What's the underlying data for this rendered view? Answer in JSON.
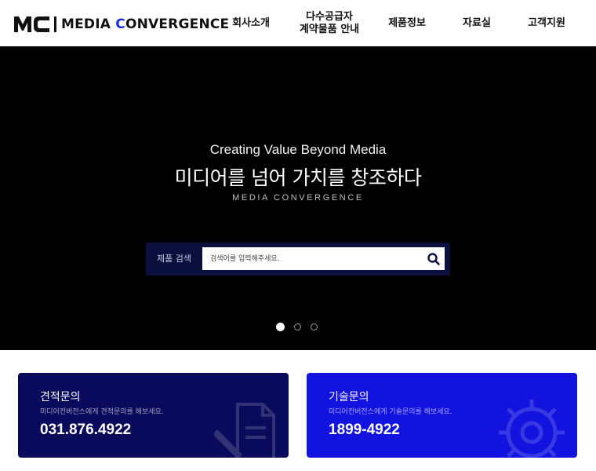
{
  "header": {
    "logo_text_prefix": "MEDIA ",
    "logo_text_c": "C",
    "logo_text_suffix": "ONVERGENCE",
    "nav": [
      {
        "label": "회사소개"
      },
      {
        "label_line1": "다수공급자",
        "label_line2": "계약물품 안내"
      },
      {
        "label": "제품정보"
      },
      {
        "label": "자료실"
      },
      {
        "label": "고객지원"
      }
    ]
  },
  "hero": {
    "subtitle": "Creating Value Beyond Media",
    "title": "미디어를 넘어 가치를 창조하다",
    "brand": "MEDIA CONVERGENCE",
    "search": {
      "label": "제품 검색",
      "placeholder": "검색어를 입력해주세요."
    },
    "slides": {
      "count": 3,
      "active": 1
    }
  },
  "cards": [
    {
      "title": "견적문의",
      "desc": "미디어컨버전스에게 견적문의를 해보세요.",
      "phone": "031.876.4922",
      "icon": "document-pencil-icon",
      "color": "#0a0a5c"
    },
    {
      "title": "기술문의",
      "desc": "미디어컨버전스에게 기술문의를 해보세요.",
      "phone": "1899-4922",
      "icon": "gear-icon",
      "color": "#1313e0"
    }
  ]
}
